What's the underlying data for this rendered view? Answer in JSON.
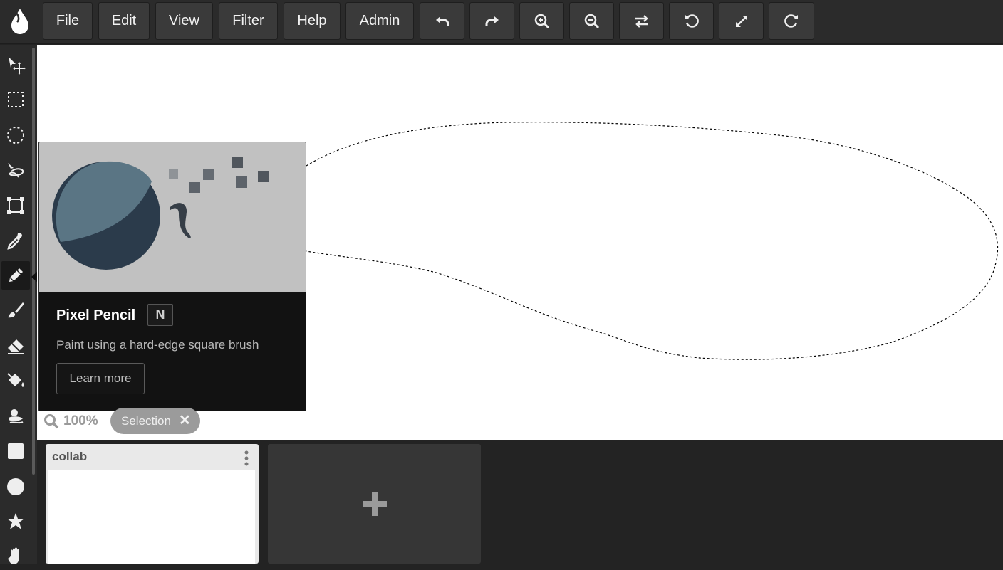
{
  "menu": {
    "file": "File",
    "edit": "Edit",
    "view": "View",
    "filter": "Filter",
    "help": "Help",
    "admin": "Admin"
  },
  "toolbar_icons": [
    "undo-icon",
    "redo-icon",
    "zoom-in-icon",
    "zoom-out-icon",
    "swap-icon",
    "rotate-left-icon",
    "expand-icon",
    "rotate-right-icon"
  ],
  "tools": [
    "move-tool-icon",
    "rect-select-icon",
    "ellipse-select-icon",
    "lasso-icon",
    "transform-icon",
    "eyedropper-icon",
    "pencil-icon",
    "brush-icon",
    "eraser-icon",
    "fill-bucket-icon",
    "smudge-icon",
    "rectangle-icon",
    "circle-icon",
    "star-icon",
    "hand-icon"
  ],
  "active_tool": "pencil-icon",
  "tooltip": {
    "title": "Pixel Pencil",
    "shortcut": "N",
    "description": "Paint using a hard-edge square brush",
    "learn_more": "Learn more"
  },
  "status": {
    "zoom": "100%",
    "selection_label": "Selection"
  },
  "layers": {
    "card_title": "collab"
  },
  "colors": {
    "toolbar_bg": "#2b2b2b",
    "button_bg": "#3a3a3a",
    "canvas_bg": "#ffffff",
    "tooltip_bg": "#121212"
  }
}
